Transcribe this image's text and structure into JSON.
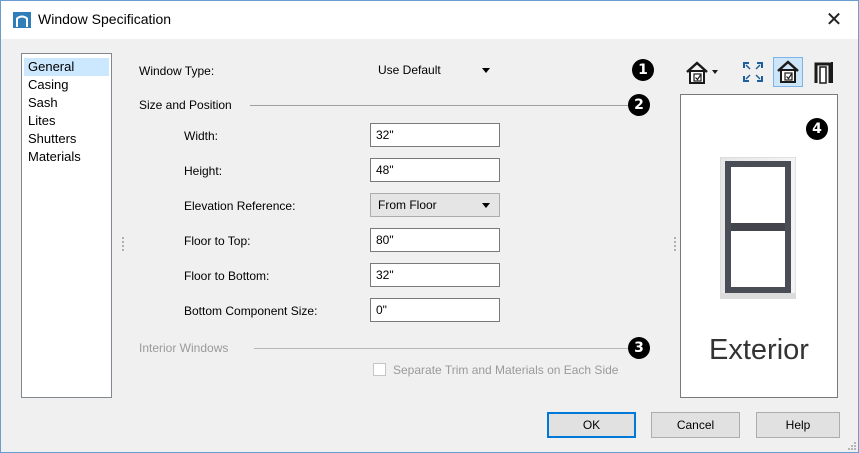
{
  "window": {
    "title": "Window Specification",
    "close_glyph": "✕"
  },
  "nav": {
    "items": [
      "General",
      "Casing",
      "Sash",
      "Lites",
      "Shutters",
      "Materials"
    ],
    "selected": "General"
  },
  "window_type": {
    "label": "Window Type:",
    "value": "Use Default"
  },
  "size_position": {
    "heading": "Size and Position",
    "width": {
      "label": "Width:",
      "value": "32\""
    },
    "height": {
      "label": "Height:",
      "value": "48\""
    },
    "elevation_reference": {
      "label": "Elevation Reference:",
      "value": "From Floor"
    },
    "floor_to_top": {
      "label": "Floor to Top:",
      "value": "80\""
    },
    "floor_to_bottom": {
      "label": "Floor to Bottom:",
      "value": "32\""
    },
    "bottom_component_size": {
      "label": "Bottom Component Size:",
      "value": "0\""
    }
  },
  "interior_windows": {
    "heading": "Interior Windows",
    "separate_trim": {
      "label": "Separate Trim and Materials on Each Side",
      "checked": false,
      "enabled": false
    }
  },
  "callouts": [
    "1",
    "2",
    "3",
    "4"
  ],
  "preview": {
    "caption": "Exterior"
  },
  "toolbar": {
    "icons": [
      "elevation-view-dropdown-icon",
      "fill-window-icon",
      "show-materials-icon",
      "wall-view-icon"
    ]
  },
  "buttons": {
    "ok": "OK",
    "cancel": "Cancel",
    "help": "Help"
  },
  "colors": {
    "accent": "#0078d7",
    "selection": "#cce8ff",
    "active_tool": "#cde6f7"
  }
}
